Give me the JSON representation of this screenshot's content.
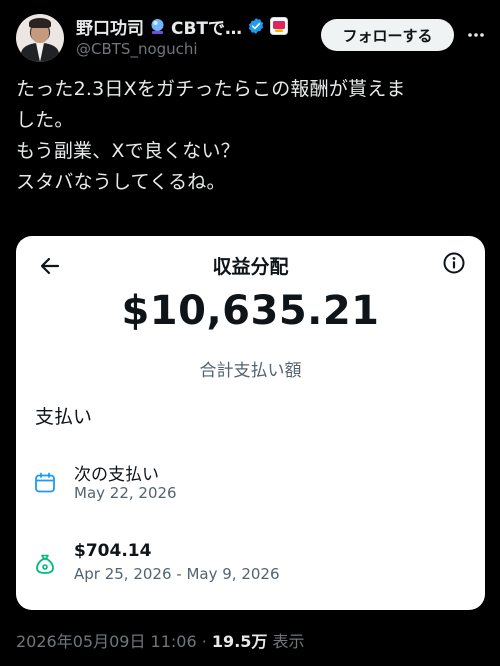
{
  "author": {
    "display_name": "野口功司",
    "name_suffix": "CBTで…",
    "handle": "@CBTS_noguchi",
    "verified_color": "#1d9bf0"
  },
  "actions": {
    "follow_label": "フォローする",
    "more_icon": "more-horizontal-icon"
  },
  "tweet": {
    "text": "たった2.3日Xをガチったらこの報酬が貰えま\nした。\nもう副業、Xで良くない？\nスタバなうしてくるね。"
  },
  "card": {
    "title": "収益分配",
    "total_amount": "$10,635.21",
    "total_label": "合計支払い額",
    "section_title": "支払い",
    "next_payment": {
      "label": "次の支払い",
      "date": "May 22, 2026",
      "icon": "calendar-icon",
      "icon_color": "#1d9bf0"
    },
    "period_payment": {
      "amount": "$704.14",
      "range": "Apr 25, 2026 - May 9, 2026",
      "icon": "money-bag-icon",
      "icon_color": "#00ba7c"
    }
  },
  "meta": {
    "timestamp": "2026年05月09日 11:06",
    "separator": "·",
    "views": "19.5万",
    "views_label": "表示"
  }
}
